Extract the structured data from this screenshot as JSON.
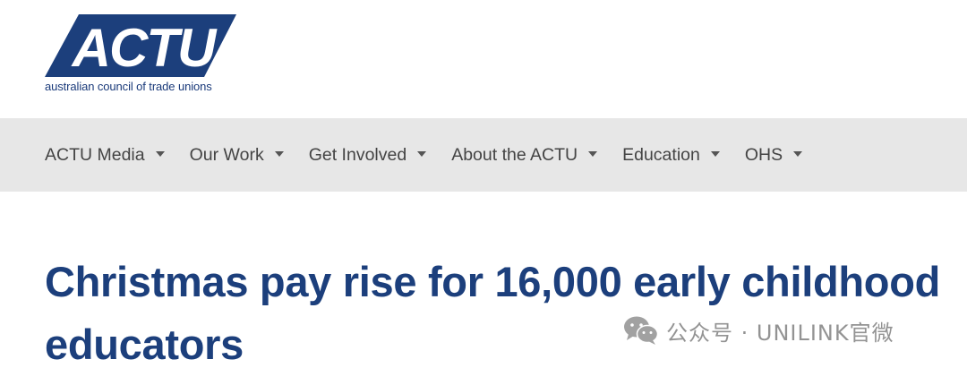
{
  "brand": {
    "logo_text": "ACTU",
    "tagline": "australian council of trade unions",
    "color_primary": "#1c3f7c"
  },
  "nav": {
    "items": [
      {
        "label": "ACTU Media"
      },
      {
        "label": "Our Work"
      },
      {
        "label": "Get Involved"
      },
      {
        "label": "About the ACTU"
      },
      {
        "label": "Education"
      },
      {
        "label": "OHS"
      }
    ],
    "background": "#e7e7e7",
    "text_color": "#444444"
  },
  "article": {
    "title": "Christmas pay rise for 16,000 early childhood educators"
  },
  "watermark": {
    "icon": "wechat-icon",
    "text": "公众号 · UNILINK官微"
  }
}
